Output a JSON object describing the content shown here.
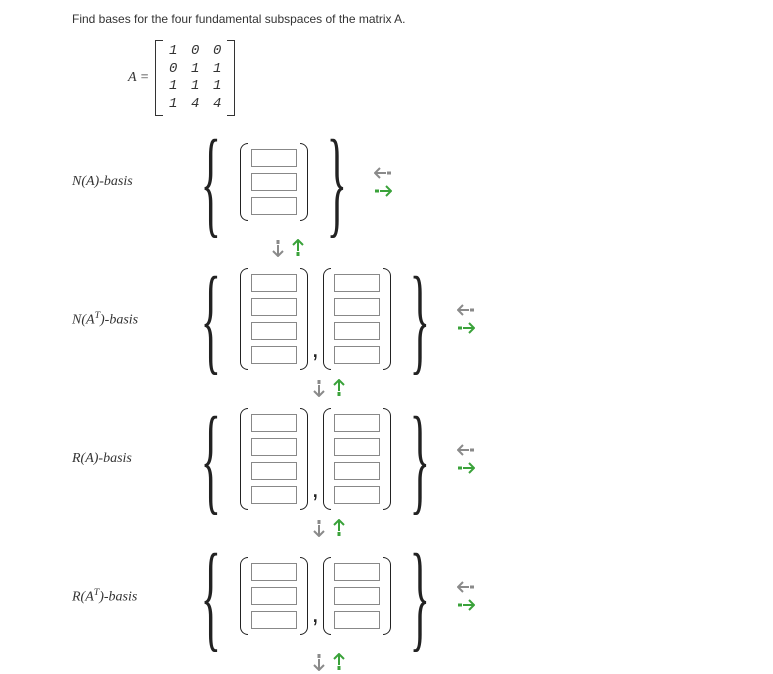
{
  "question": "Find bases for the four fundamental subspaces of the matrix A.",
  "matrix_name": "A =",
  "matrix": [
    [
      "1",
      "0",
      "0"
    ],
    [
      "0",
      "1",
      "1"
    ],
    [
      "1",
      "1",
      "1"
    ],
    [
      "1",
      "4",
      "4"
    ]
  ],
  "subspaces": [
    {
      "label_html": "N(A)-basis",
      "vectors": 1,
      "rows": 3
    },
    {
      "label_html": "N(A<sup>T</sup>)-basis",
      "vectors": 2,
      "rows": 4
    },
    {
      "label_html": "R(A)-basis",
      "vectors": 2,
      "rows": 4
    },
    {
      "label_html": "R(A<sup>T</sup>)-basis",
      "vectors": 2,
      "rows": 3
    }
  ]
}
